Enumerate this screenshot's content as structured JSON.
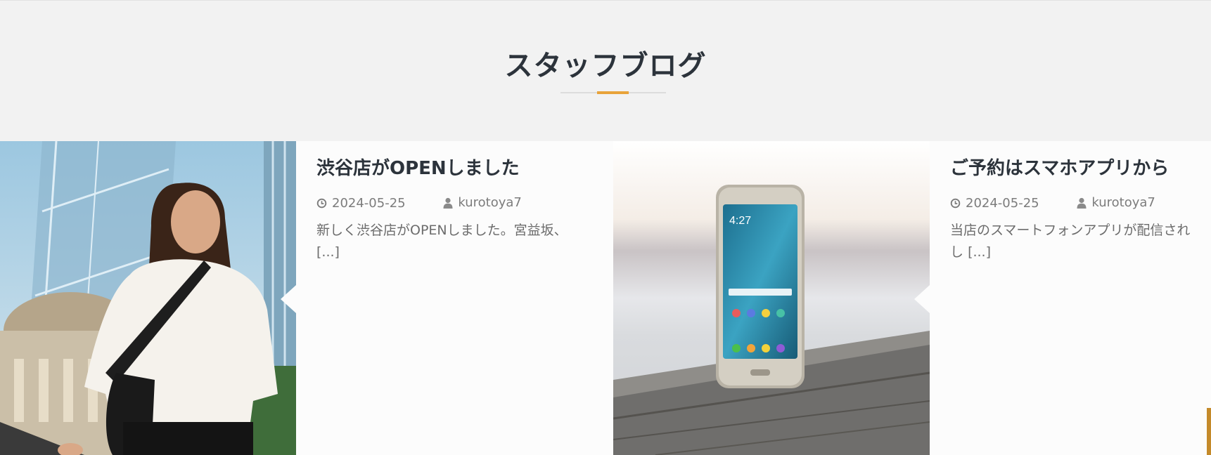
{
  "section": {
    "title": "スタッフブログ"
  },
  "colors": {
    "accent": "#e8a33a",
    "title_text": "#2c333b",
    "meta_text": "#7c7c7c"
  },
  "posts": [
    {
      "title": "渋谷店がOPENしました",
      "date": "2024-05-25",
      "author": "kurotoya7",
      "excerpt": "新しく渋谷店がOPENしました。宮益坂、",
      "read_more": "[...]",
      "date_icon": "clock-icon",
      "author_icon": "user-icon",
      "image_subject": "woman-in-white-blouse"
    },
    {
      "title": "ご予約はスマホアプリから",
      "date": "2024-05-25",
      "author": "kurotoya7",
      "excerpt": "当店のスマートフォンアプリが配信され",
      "excerpt_line2": "し",
      "read_more": "[...]",
      "date_icon": "clock-icon",
      "author_icon": "user-icon",
      "image_subject": "smartphone-on-wooden-table"
    }
  ]
}
